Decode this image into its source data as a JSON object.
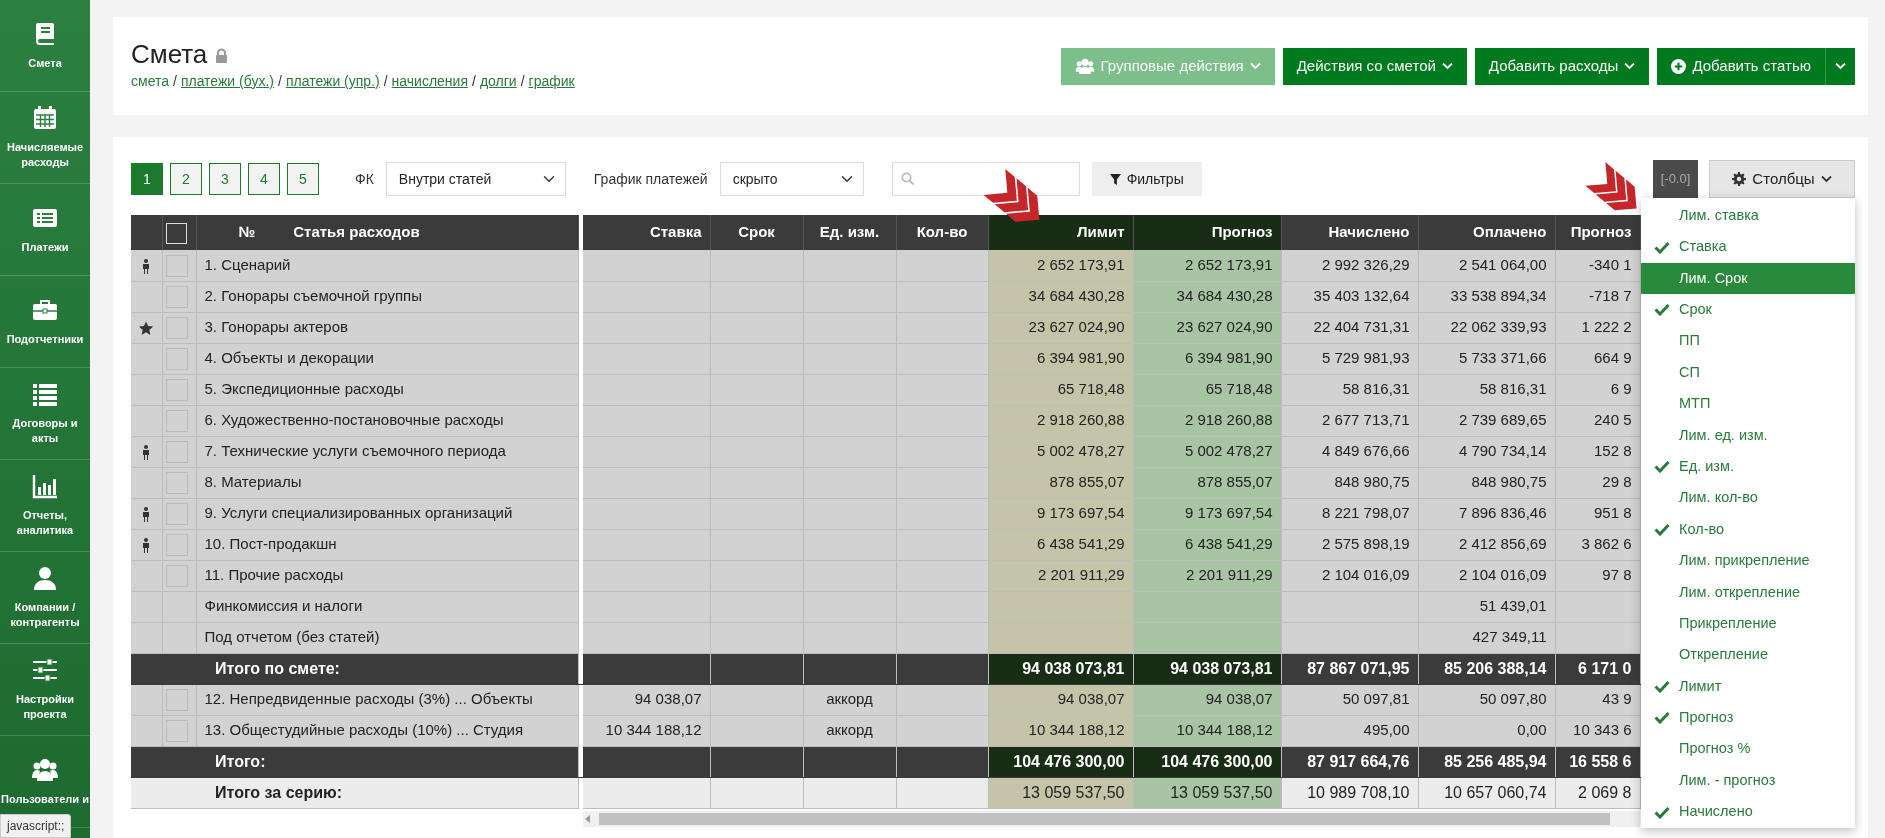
{
  "sidebar": {
    "items": [
      {
        "label": "Смета"
      },
      {
        "label": "Начисляемые расходы"
      },
      {
        "label": "Платежи"
      },
      {
        "label": "Подотчетники"
      },
      {
        "label": "Договоры и акты"
      },
      {
        "label": "Отчеты, аналитика"
      },
      {
        "label": "Компании / контрагенты"
      },
      {
        "label": "Настройки проекта"
      },
      {
        "label": "Пользователи и"
      }
    ]
  },
  "header": {
    "title": "Смета",
    "locked": true,
    "breadcrumb": [
      {
        "label": "смета",
        "current": true
      },
      {
        "prefix": "/",
        "label": "платежи (бух.)",
        "current": false
      },
      {
        "prefix": "/",
        "label": "платежи (упр.)",
        "current": false
      },
      {
        "prefix": "/",
        "label": "начисления",
        "current": false
      },
      {
        "prefix": "/",
        "label": "долги",
        "current": false
      },
      {
        "prefix": "/",
        "label": "график",
        "current": false
      }
    ],
    "buttons": [
      {
        "label": "Групповые действия",
        "kind": "group"
      },
      {
        "label": "Действия со сметой",
        "kind": "menu"
      },
      {
        "label": "Добавить расходы",
        "kind": "menu"
      },
      {
        "label": "Добавить статью",
        "kind": "add"
      }
    ]
  },
  "toolbar": {
    "pages": [
      {
        "label": "1",
        "selected": true
      },
      {
        "label": "2",
        "selected": false
      },
      {
        "label": "3",
        "selected": false
      },
      {
        "label": "4",
        "selected": false
      },
      {
        "label": "5",
        "selected": false
      }
    ],
    "fk": {
      "label": "ФК",
      "value": "Внутри статей"
    },
    "schedule": {
      "label": "График платежей",
      "value": "скрыто"
    },
    "filters_button": "Фильтры",
    "delta_badge": "[-0.0]",
    "columns_button": "Столбцы"
  },
  "table": {
    "select_all": {
      "checked": false
    },
    "number_header": "№",
    "name_header": "Статья расходов",
    "columns": [
      {
        "label": "Ставка",
        "kind": "number"
      },
      {
        "label": "Срок",
        "kind": "text"
      },
      {
        "label": "Ед. изм.",
        "kind": "text"
      },
      {
        "label": "Кол-во",
        "kind": "text"
      },
      {
        "label": "Лимит",
        "kind": "limit"
      },
      {
        "label": "Прогноз",
        "kind": "forecast"
      },
      {
        "label": "Начислено",
        "kind": "number"
      },
      {
        "label": "Оплачено",
        "kind": "number"
      },
      {
        "label": "Прогноз",
        "kind": "number"
      }
    ],
    "rows": [
      {
        "kind": "item",
        "assigned": true,
        "starred": false,
        "checked": false,
        "name": "1. Сценарий",
        "cells": [
          null,
          null,
          null,
          null,
          "2 652 173,91",
          "2 652 173,91",
          "2 992 326,29",
          "2 541 064,00",
          "-340 1"
        ]
      },
      {
        "kind": "item",
        "assigned": false,
        "starred": false,
        "checked": false,
        "name": "2. Гонорары съемочной группы",
        "cells": [
          null,
          null,
          null,
          null,
          "34 684 430,28",
          "34 684 430,28",
          "35 403 132,64",
          "33 538 894,34",
          "-718 7"
        ]
      },
      {
        "kind": "item",
        "assigned": false,
        "starred": true,
        "checked": false,
        "name": "3. Гонорары актеров",
        "cells": [
          null,
          null,
          null,
          null,
          "23 627 024,90",
          "23 627 024,90",
          "22 404 731,31",
          "22 062 339,93",
          "1 222 2"
        ]
      },
      {
        "kind": "item",
        "assigned": false,
        "starred": false,
        "checked": false,
        "name": "4. Объекты и декорации",
        "cells": [
          null,
          null,
          null,
          null,
          "6 394 981,90",
          "6 394 981,90",
          "5 729 981,93",
          "5 733 371,66",
          "664 9"
        ]
      },
      {
        "kind": "item",
        "assigned": false,
        "starred": false,
        "checked": false,
        "name": "5. Экспедиционные расходы",
        "cells": [
          null,
          null,
          null,
          null,
          "65 718,48",
          "65 718,48",
          "58 816,31",
          "58 816,31",
          "6 9"
        ]
      },
      {
        "kind": "item",
        "assigned": false,
        "starred": false,
        "checked": false,
        "name": "6. Художественно-постановочные расходы",
        "cells": [
          null,
          null,
          null,
          null,
          "2 918 260,88",
          "2 918 260,88",
          "2 677 713,71",
          "2 739 689,65",
          "240 5"
        ]
      },
      {
        "kind": "item",
        "assigned": true,
        "starred": false,
        "checked": false,
        "name": "7. Технические услуги съемочного периода",
        "cells": [
          null,
          null,
          null,
          null,
          "5 002 478,27",
          "5 002 478,27",
          "4 849 676,66",
          "4 790 734,14",
          "152 8"
        ]
      },
      {
        "kind": "item",
        "assigned": false,
        "starred": false,
        "checked": false,
        "name": "8. Материалы",
        "cells": [
          null,
          null,
          null,
          null,
          "878 855,07",
          "878 855,07",
          "848 980,75",
          "848 980,75",
          "29 8"
        ]
      },
      {
        "kind": "item",
        "assigned": true,
        "starred": false,
        "checked": false,
        "name": "9. Услуги специализированных организаций",
        "cells": [
          null,
          null,
          null,
          null,
          "9 173 697,54",
          "9 173 697,54",
          "8 221 798,07",
          "7 896 836,46",
          "951 8"
        ]
      },
      {
        "kind": "item",
        "assigned": true,
        "starred": false,
        "checked": false,
        "name": "10. Пост-продакшн",
        "cells": [
          null,
          null,
          null,
          null,
          "6 438 541,29",
          "6 438 541,29",
          "2 575 898,19",
          "2 412 856,69",
          "3 862 6"
        ]
      },
      {
        "kind": "item",
        "assigned": false,
        "starred": false,
        "checked": false,
        "name": "11. Прочие расходы",
        "cells": [
          null,
          null,
          null,
          null,
          "2 201 911,29",
          "2 201 911,29",
          "2 104 016,09",
          "2 104 016,09",
          "97 8"
        ]
      },
      {
        "kind": "item",
        "name": "Финкомиссия и налоги",
        "cells": [
          null,
          null,
          null,
          null,
          null,
          null,
          null,
          "51 439,01",
          null
        ]
      },
      {
        "kind": "item",
        "name": "Под отчетом (без статей)",
        "cells": [
          null,
          null,
          null,
          null,
          null,
          null,
          null,
          "427 349,11",
          null
        ]
      },
      {
        "kind": "total",
        "name": "Итого по смете:",
        "cells": [
          null,
          null,
          null,
          null,
          "94 038 073,81",
          "94 038 073,81",
          "87 867 071,95",
          "85 206 388,14",
          "6 171 0"
        ]
      },
      {
        "kind": "item",
        "assigned": false,
        "starred": false,
        "checked": false,
        "name": "12. Непредвиденные расходы (3%) ... Объекты",
        "cells": [
          "94 038,07",
          null,
          "аккорд",
          null,
          "94 038,07",
          "94 038,07",
          "50 097,81",
          "50 097,80",
          "43 9"
        ]
      },
      {
        "kind": "item",
        "assigned": false,
        "starred": false,
        "checked": false,
        "name": "13. Общестудийные расходы (10%) ... Студия",
        "cells": [
          "10 344 188,12",
          null,
          "аккорд",
          null,
          "10 344 188,12",
          "10 344 188,12",
          "495,00",
          "0,00",
          "10 343 6"
        ]
      },
      {
        "kind": "total",
        "name": "Итого:",
        "cells": [
          null,
          null,
          null,
          null,
          "104 476 300,00",
          "104 476 300,00",
          "87 917 664,76",
          "85 256 485,94",
          "16 558 6"
        ]
      },
      {
        "kind": "series",
        "name": "Итого за серию:",
        "cells": [
          null,
          null,
          null,
          null,
          "13 059 537,50",
          "13 059 537,50",
          "10 989 708,10",
          "10 657 060,74",
          "2 069 8"
        ]
      }
    ]
  },
  "columns_menu": {
    "items": [
      {
        "label": "Лим. ставка",
        "checked": false,
        "selected": false
      },
      {
        "label": "Ставка",
        "checked": true,
        "selected": false
      },
      {
        "label": "Лим. Срок",
        "checked": false,
        "selected": true
      },
      {
        "label": "Срок",
        "checked": true,
        "selected": false
      },
      {
        "label": "ПП",
        "checked": false,
        "selected": false
      },
      {
        "label": "СП",
        "checked": false,
        "selected": false
      },
      {
        "label": "МТП",
        "checked": false,
        "selected": false
      },
      {
        "label": "Лим. ед. изм.",
        "checked": false,
        "selected": false
      },
      {
        "label": "Ед. изм.",
        "checked": true,
        "selected": false
      },
      {
        "label": "Лим. кол-во",
        "checked": false,
        "selected": false
      },
      {
        "label": "Кол-во",
        "checked": true,
        "selected": false
      },
      {
        "label": "Лим. прикрепление",
        "checked": false,
        "selected": false
      },
      {
        "label": "Лим. открепление",
        "checked": false,
        "selected": false
      },
      {
        "label": "Прикрепление",
        "checked": false,
        "selected": false
      },
      {
        "label": "Открепление",
        "checked": false,
        "selected": false
      },
      {
        "label": "Лимит",
        "checked": true,
        "selected": false
      },
      {
        "label": "Прогноз",
        "checked": true,
        "selected": false
      },
      {
        "label": "Прогноз %",
        "checked": false,
        "selected": false
      },
      {
        "label": "Лим. - прогноз",
        "checked": false,
        "selected": false
      },
      {
        "label": "Начислено",
        "checked": true,
        "selected": false
      }
    ]
  },
  "status_bar": {
    "text": "javascript:;"
  }
}
